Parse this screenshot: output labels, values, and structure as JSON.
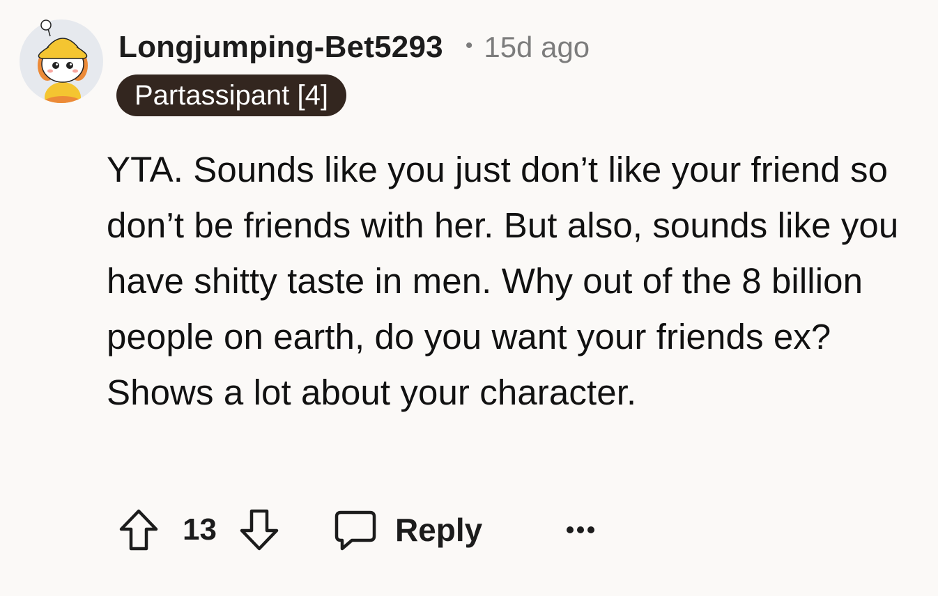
{
  "comment": {
    "author": "Longjumping-Bet5293",
    "separator": "•",
    "time": "15d ago",
    "flair": "Partassipant [4]",
    "body": "YTA. Sounds like you just don’t like your friend so don’t be friends with her. But also, sounds like you have shitty taste in men. Why out of the 8 billion people on earth, do you want your friends ex? Shows a lot about your character."
  },
  "actions": {
    "score": "13",
    "reply_label": "Reply",
    "upvote_icon": "upvote-arrow-icon",
    "downvote_icon": "downvote-arrow-icon",
    "reply_icon": "speech-bubble-icon",
    "more_icon": "ellipsis-icon"
  },
  "colors": {
    "background": "#fbf9f7",
    "flair_bg": "#33261f",
    "muted_text": "#7c7c7c",
    "avatar_hat": "#f4c531",
    "avatar_hair": "#ec8a38"
  }
}
